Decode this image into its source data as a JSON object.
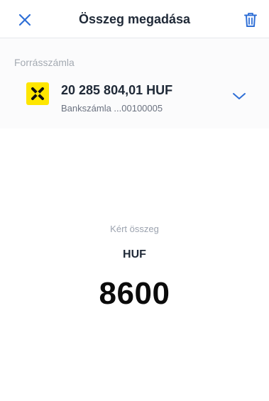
{
  "header": {
    "title": "Összeg megadása",
    "close_icon": "close-icon",
    "delete_icon": "trash-icon"
  },
  "source": {
    "label": "Forrásszámla",
    "account": {
      "amount": "20 285 804,01 HUF",
      "number": "Bankszámla ...00100005",
      "logo_icon": "bank-logo-icon",
      "expand_icon": "chevron-down-icon"
    }
  },
  "request": {
    "label": "Kért összeg",
    "currency": "HUF",
    "amount": "8600"
  },
  "colors": {
    "accent": "#2f6fd6",
    "logo_bg": "#fee600",
    "text_primary": "#1f2937",
    "text_muted": "#9ca3af"
  }
}
